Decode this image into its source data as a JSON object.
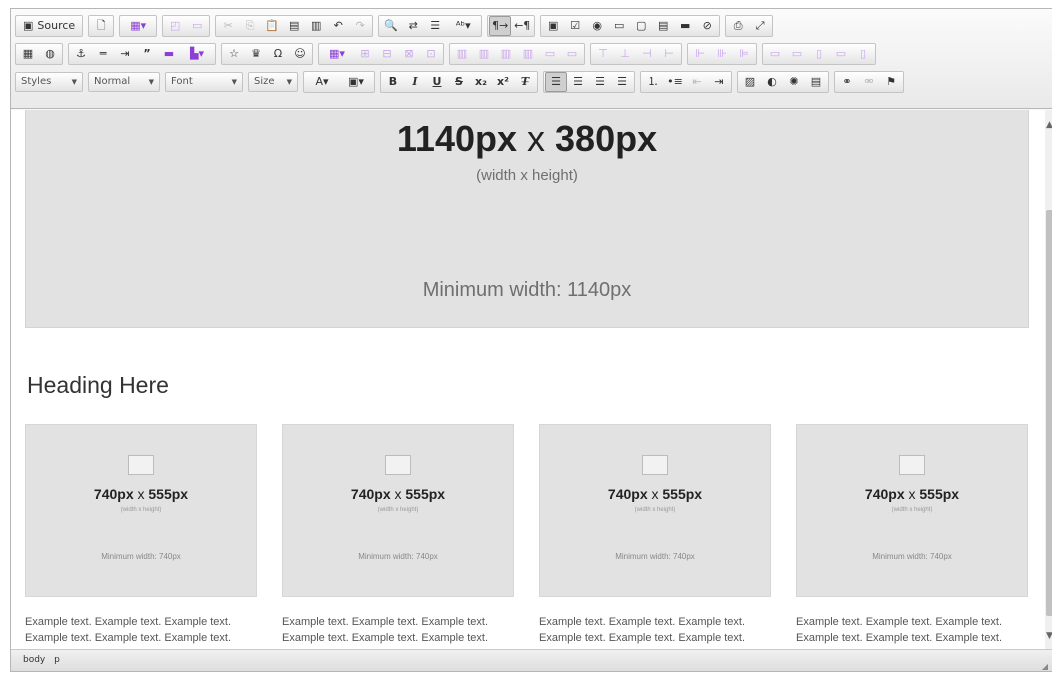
{
  "toolbar": {
    "source_label": "Source",
    "styles_label": "Styles",
    "format_label": "Normal",
    "font_label": "Font",
    "size_label": "Size"
  },
  "hero": {
    "size_a": "1140px",
    "size_x": " x ",
    "size_b": "380px",
    "subtitle": "(width x height)",
    "min_width": "Minimum width: 1140px"
  },
  "heading": "Heading Here",
  "cards": [
    {
      "size_a": "740px",
      "size_x": " x ",
      "size_b": "555px",
      "subtitle": "(width x height)",
      "min_width": "Minimum width: 740px",
      "text": "Example text. Example text. Example text. Example text. Example text. Example text."
    },
    {
      "size_a": "740px",
      "size_x": " x ",
      "size_b": "555px",
      "subtitle": "(width x height)",
      "min_width": "Minimum width: 740px",
      "text": "Example text. Example text. Example text. Example text. Example text. Example text."
    },
    {
      "size_a": "740px",
      "size_x": " x ",
      "size_b": "555px",
      "subtitle": "(width x height)",
      "min_width": "Minimum width: 740px",
      "text": "Example text. Example text. Example text. Example text. Example text. Example text."
    },
    {
      "size_a": "740px",
      "size_x": " x ",
      "size_b": "555px",
      "subtitle": "(width x height)",
      "min_width": "Minimum width: 740px",
      "text": "Example text. Example text. Example text. Example text. Example text. Example text."
    }
  ],
  "statusbar": {
    "path": [
      "body",
      "p"
    ]
  }
}
